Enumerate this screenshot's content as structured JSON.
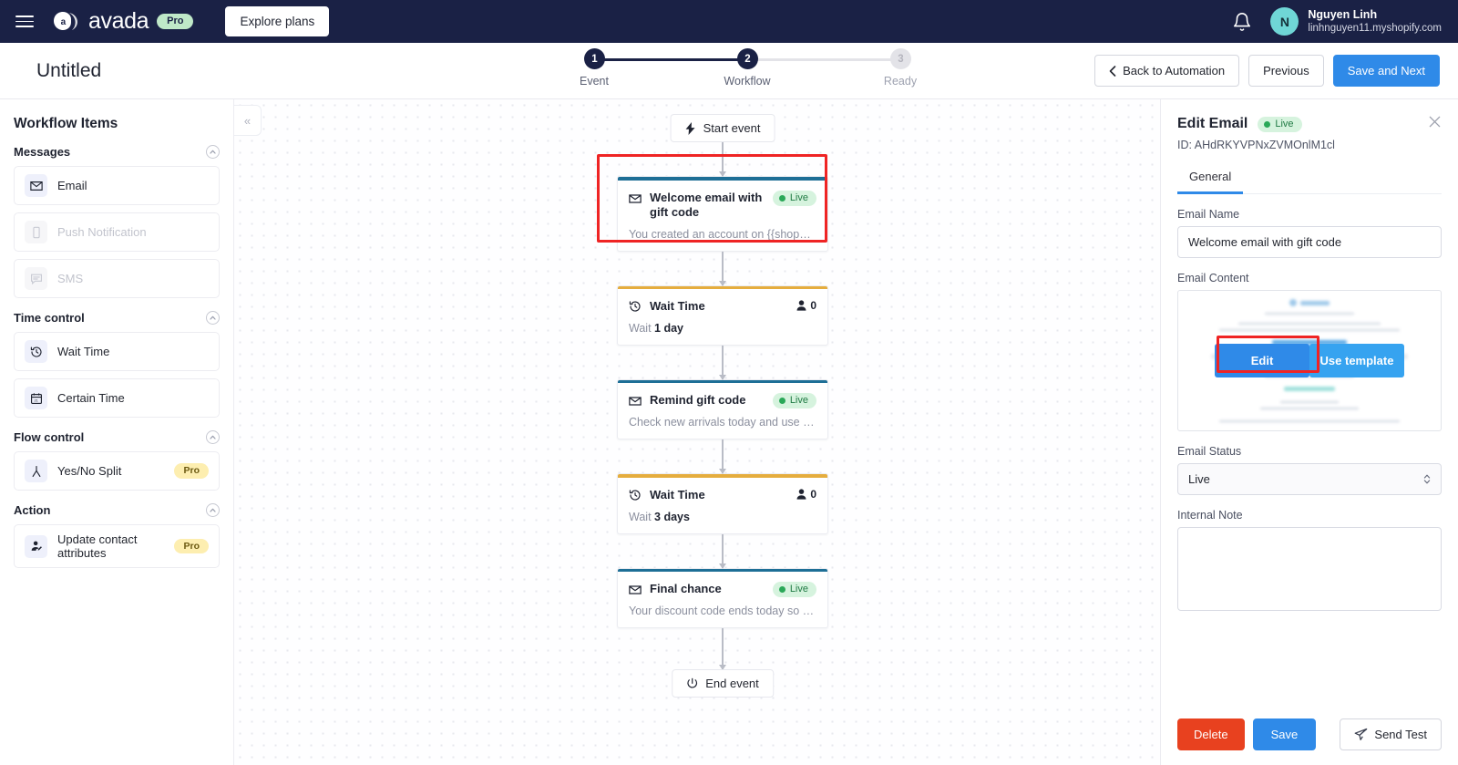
{
  "topbar": {
    "brand": "avada",
    "brand_badge": "Pro",
    "explore_label": "Explore plans",
    "user_name": "Nguyen Linh",
    "user_shop": "linhnguyen11.myshopify.com",
    "avatar_initial": "N"
  },
  "header": {
    "title": "Untitled",
    "steps": [
      {
        "num": "1",
        "label": "Event",
        "state": "active"
      },
      {
        "num": "2",
        "label": "Workflow",
        "state": "active"
      },
      {
        "num": "3",
        "label": "Ready",
        "state": "inactive"
      }
    ],
    "back_label": "Back to Automation",
    "previous_label": "Previous",
    "save_next_label": "Save and Next"
  },
  "sidebar": {
    "title": "Workflow Items",
    "groups": [
      {
        "name": "Messages",
        "items": [
          {
            "label": "Email",
            "icon": "envelope-icon",
            "disabled": false,
            "badge": ""
          },
          {
            "label": "Push Notification",
            "icon": "mobile-icon",
            "disabled": true,
            "badge": ""
          },
          {
            "label": "SMS",
            "icon": "chat-icon",
            "disabled": true,
            "badge": ""
          }
        ]
      },
      {
        "name": "Time control",
        "items": [
          {
            "label": "Wait Time",
            "icon": "clock-rewind-icon",
            "disabled": false,
            "badge": ""
          },
          {
            "label": "Certain Time",
            "icon": "calendar-icon",
            "disabled": false,
            "badge": ""
          }
        ]
      },
      {
        "name": "Flow control",
        "items": [
          {
            "label": "Yes/No Split",
            "icon": "split-icon",
            "disabled": false,
            "badge": "Pro"
          }
        ]
      },
      {
        "name": "Action",
        "items": [
          {
            "label": "Update contact attributes",
            "icon": "user-edit-icon",
            "disabled": false,
            "badge": "Pro"
          }
        ]
      }
    ]
  },
  "canvas": {
    "collapse_icon": "«",
    "start_label": "Start event",
    "end_label": "End event",
    "nodes": [
      {
        "type": "email",
        "title": "Welcome email with gift code",
        "badge": "Live",
        "preview": "You created an account on {{shop_name}}. H...",
        "highlighted": true
      },
      {
        "type": "wait",
        "title": "Wait Time",
        "count": "0",
        "prefix": "Wait",
        "value": "1 day"
      },
      {
        "type": "email",
        "title": "Remind gift code",
        "badge": "Live",
        "preview": "Check new arrivals today and use your gift c..."
      },
      {
        "type": "wait",
        "title": "Wait Time",
        "count": "0",
        "prefix": "Wait",
        "value": "3 days"
      },
      {
        "type": "email",
        "title": "Final chance",
        "badge": "Live",
        "preview": "Your discount code ends today so why not t..."
      }
    ]
  },
  "panel": {
    "title": "Edit Email",
    "status_badge": "Live",
    "id_text": "ID: AHdRKYVPNxZVMOnlM1cl",
    "tabs": [
      {
        "label": "General",
        "active": true
      }
    ],
    "email_name_label": "Email Name",
    "email_name_value": "Welcome email with gift code",
    "email_content_label": "Email Content",
    "edit_label": "Edit",
    "use_template_label": "Use template",
    "email_status_label": "Email Status",
    "email_status_value": "Live",
    "internal_note_label": "Internal Note",
    "internal_note_value": "",
    "delete_label": "Delete",
    "save_label": "Save",
    "send_test_label": "Send Test"
  },
  "colors": {
    "navy": "#1a2145",
    "blue": "#2f8ae8",
    "red": "#e8411f",
    "highlight": "#ef2424",
    "email_bar": "#1e6f96",
    "wait_bar": "#e5ad3e",
    "live_green": "#2aa858"
  }
}
